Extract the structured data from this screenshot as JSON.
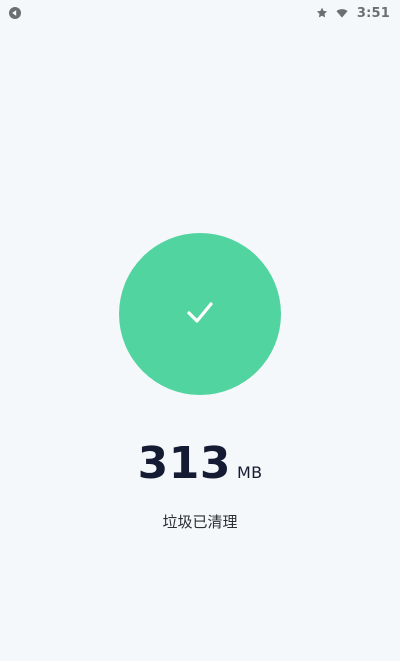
{
  "status_bar": {
    "time": "3:51",
    "icons": {
      "left": "app-notification-icon",
      "right": [
        "star-icon",
        "wifi-icon"
      ]
    }
  },
  "result": {
    "icon": "checkmark-icon",
    "size_value": "313",
    "size_unit": "MB",
    "message": "垃圾已清理"
  },
  "colors": {
    "background": "#f5f8fb",
    "success": "#52d4a0",
    "primary_text": "#141b33",
    "secondary_text": "#2b2f36",
    "status_icons": "#6b6f74"
  }
}
